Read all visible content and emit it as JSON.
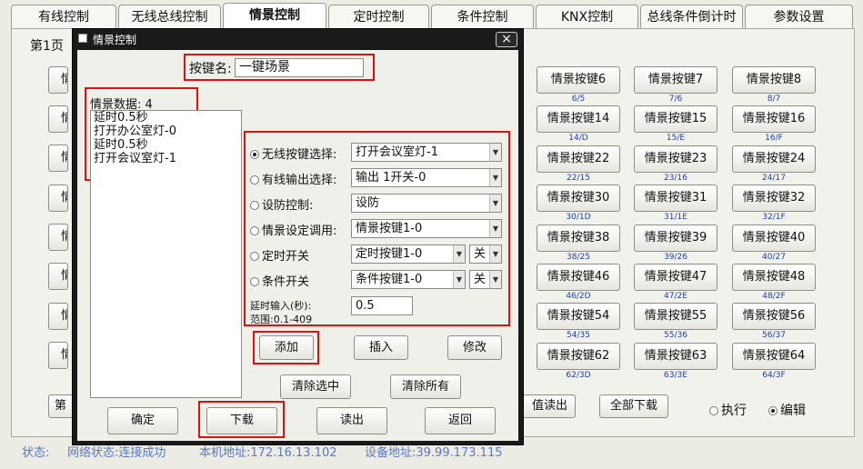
{
  "tabs": [
    "有线控制",
    "无线总线控制",
    "情景控制",
    "定时控制",
    "条件控制",
    "KNX控制",
    "总线条件倒计时",
    "参数设置"
  ],
  "active_tab": "情景控制",
  "page_label": "第1页",
  "left_buttons": [
    "情",
    "情",
    "情",
    "情",
    "情",
    "情",
    "情",
    "情"
  ],
  "scene_rows": [
    [
      {
        "l": "情景按键6",
        "h": "6/5"
      },
      {
        "l": "情景按键7",
        "h": "7/6"
      },
      {
        "l": "情景按键8",
        "h": "8/7"
      }
    ],
    [
      {
        "l": "情景按键14",
        "h": "14/D"
      },
      {
        "l": "情景按键15",
        "h": "15/E"
      },
      {
        "l": "情景按键16",
        "h": "16/F"
      }
    ],
    [
      {
        "l": "情景按键22",
        "h": "22/15"
      },
      {
        "l": "情景按键23",
        "h": "23/16"
      },
      {
        "l": "情景按键24",
        "h": "24/17"
      }
    ],
    [
      {
        "l": "情景按键30",
        "h": "30/1D"
      },
      {
        "l": "情景按键31",
        "h": "31/1E"
      },
      {
        "l": "情景按键32",
        "h": "32/1F"
      }
    ],
    [
      {
        "l": "情景按键38",
        "h": "38/25"
      },
      {
        "l": "情景按键39",
        "h": "39/26"
      },
      {
        "l": "情景按键40",
        "h": "40/27"
      }
    ],
    [
      {
        "l": "情景按键46",
        "h": "46/2D"
      },
      {
        "l": "情景按键47",
        "h": "47/2E"
      },
      {
        "l": "情景按键48",
        "h": "48/2F"
      }
    ],
    [
      {
        "l": "情景按键54",
        "h": "54/35"
      },
      {
        "l": "情景按键55",
        "h": "55/36"
      },
      {
        "l": "情景按键56",
        "h": "56/37"
      }
    ],
    [
      {
        "l": "情景按键62",
        "h": "62/3D"
      },
      {
        "l": "情景按键63",
        "h": "63/3E"
      },
      {
        "l": "情景按键64",
        "h": "64/3F"
      }
    ]
  ],
  "bottom": {
    "first_btn": "第一",
    "partial_btn": "值读出",
    "download_all": "全部下载",
    "mode_execute": "执行",
    "mode_edit": "编辑",
    "mode_selected": "编辑"
  },
  "status": {
    "label": "状态:",
    "network": "网络状态:连接成功",
    "local_addr": "本机地址:172.16.13.102",
    "device_addr": "设备地址:39.99.173.115"
  },
  "dialog": {
    "title": "情景控制",
    "close": "×",
    "key_name_label": "按键名:",
    "key_name_value": "一键场景",
    "scene_data_label": "情景数据: 4",
    "scene_data_items": [
      "延时0.5秒",
      "打开办公室灯-0",
      "延时0.5秒",
      "打开会议室灯-1"
    ],
    "options": [
      {
        "label": "无线按键选择:",
        "value": "打开会议室灯-1",
        "checked": true
      },
      {
        "label": "有线输出选择:",
        "value": "输出 1开关-0",
        "checked": false
      },
      {
        "label": "设防控制:",
        "value": "设防",
        "checked": false
      },
      {
        "label": "情景设定调用:",
        "value": "情景按键1-0",
        "checked": false
      },
      {
        "label": "定时开关",
        "value": "定时按键1-0",
        "checked": false,
        "extra": "关"
      },
      {
        "label": "条件开关",
        "value": "条件按键1-0",
        "checked": false,
        "extra": "关"
      }
    ],
    "delay_label": "延时输入(秒):",
    "delay_range": "范围:0.1-409",
    "delay_value": "0.5",
    "add": "添加",
    "insert": "插入",
    "modify": "修改",
    "clear_selected": "清除选中",
    "clear_all": "清除所有",
    "confirm": "确定",
    "download": "下载",
    "read": "读出",
    "back": "返回"
  },
  "colors": {
    "highlight": "#e01010",
    "hex_label": "#1a3fb0",
    "status": "#5a7abf"
  }
}
